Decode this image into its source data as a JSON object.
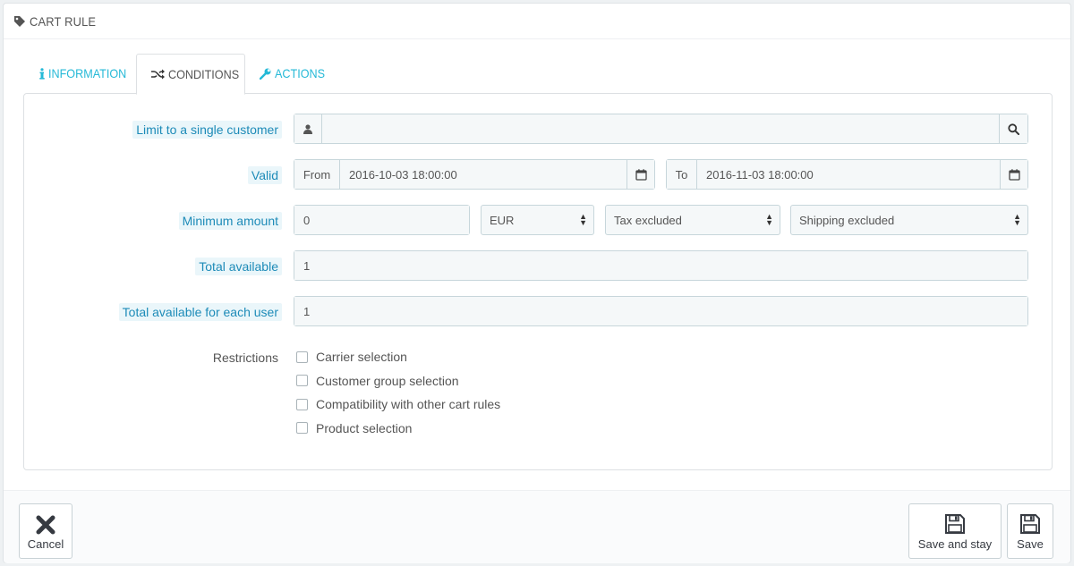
{
  "panel": {
    "title": "CART RULE",
    "title_icon": "tag-icon"
  },
  "tabs": [
    {
      "label": "INFORMATION",
      "icon": "info-icon",
      "active": false
    },
    {
      "label": "CONDITIONS",
      "icon": "shuffle-icon",
      "active": true
    },
    {
      "label": "ACTIONS",
      "icon": "wrench-icon",
      "active": false
    }
  ],
  "form": {
    "customer": {
      "label": "Limit to a single customer",
      "value": ""
    },
    "valid": {
      "label": "Valid",
      "from_label": "From",
      "from_value": "2016-10-03 18:00:00",
      "to_label": "To",
      "to_value": "2016-11-03 18:00:00"
    },
    "minimum_amount": {
      "label": "Minimum amount",
      "value": "0",
      "currency": "EUR",
      "tax": "Tax excluded",
      "shipping": "Shipping excluded"
    },
    "total_available": {
      "label": "Total available",
      "value": "1"
    },
    "total_per_user": {
      "label": "Total available for each user",
      "value": "1"
    },
    "restrictions": {
      "label": "Restrictions",
      "items": [
        "Carrier selection",
        "Customer group selection",
        "Compatibility with other cart rules",
        "Product selection"
      ]
    }
  },
  "footer": {
    "cancel_label": "Cancel",
    "save_stay_label": "Save and stay",
    "save_label": "Save"
  },
  "colors": {
    "accent": "#25b9d7",
    "label_text": "#1d8bb8",
    "label_bg": "#eaf6fa"
  }
}
